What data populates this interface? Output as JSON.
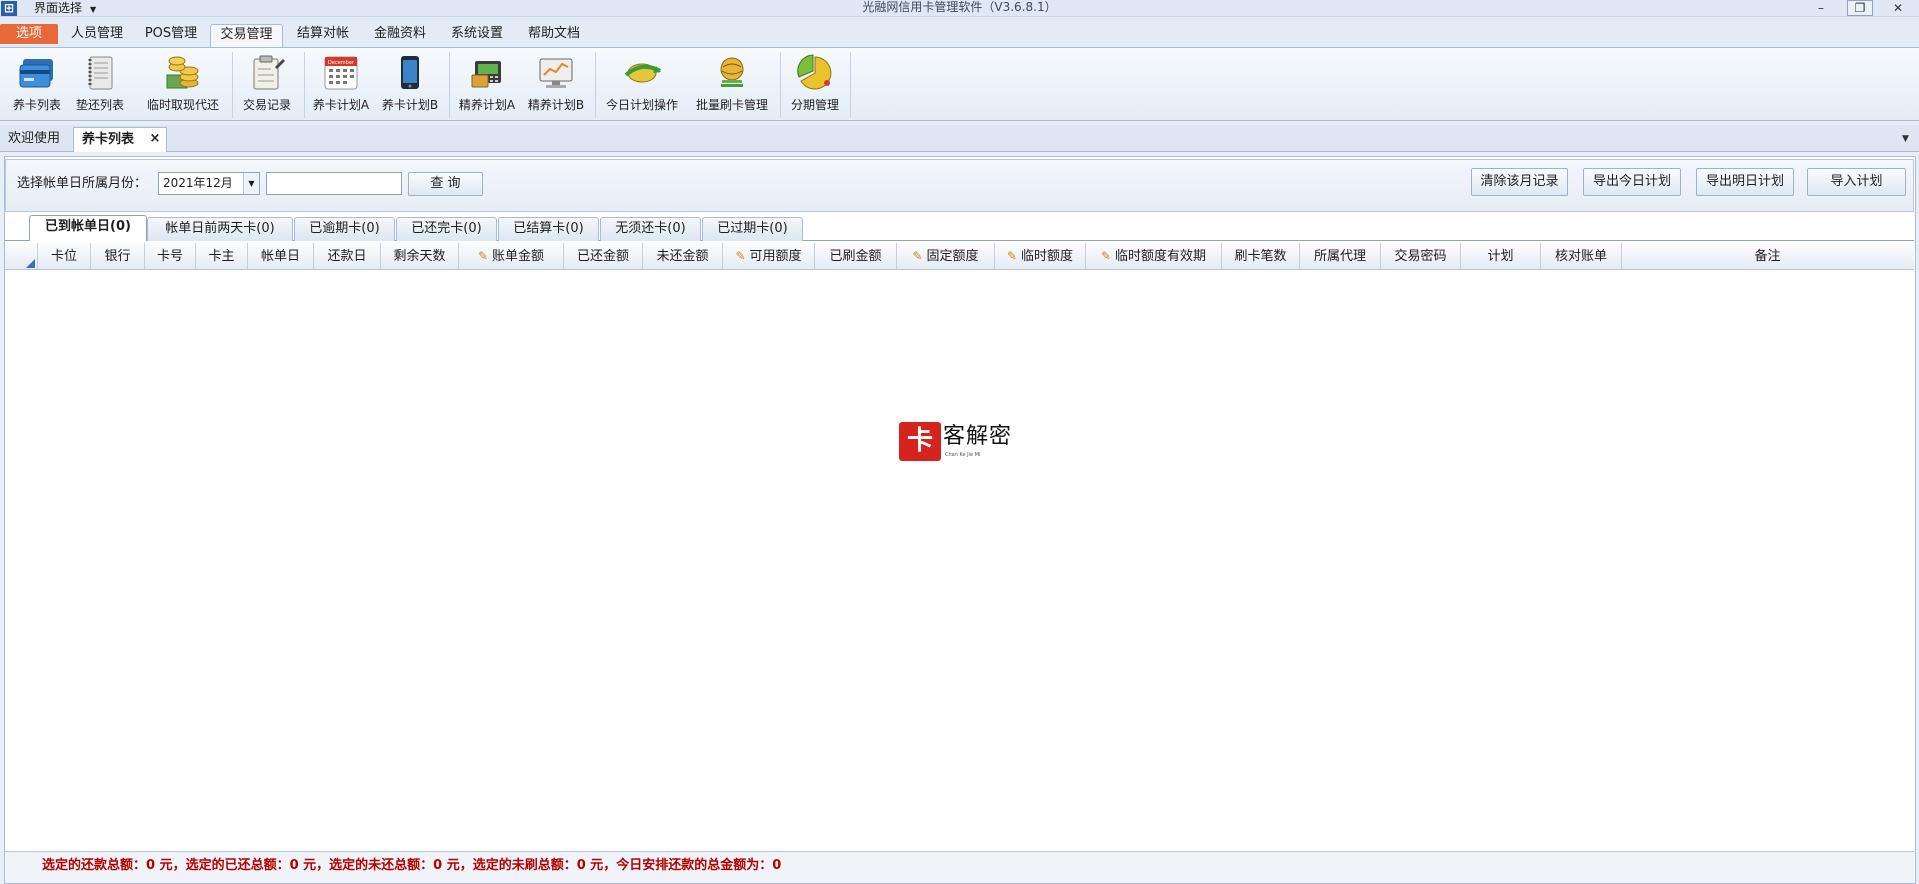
{
  "app": {
    "icon": "grid-app-icon",
    "view_select": "界面选择",
    "title": "光融网信用卡管理软件（V3.6.8.1）",
    "window_buttons": {
      "minimize": "–",
      "restore": "❐",
      "close": "✕"
    }
  },
  "menu_tabs": [
    "选项",
    "人员管理",
    "POS管理",
    "交易管理",
    "结算对帐",
    "金融资料",
    "系统设置",
    "帮助文档"
  ],
  "active_menu_tab": "交易管理",
  "ribbon": {
    "buttons": [
      {
        "label": "养卡列表",
        "icon": "card-list-icon"
      },
      {
        "label": "垫还列表",
        "icon": "notebook-icon"
      },
      {
        "label": "临时取现代还",
        "icon": "coins-icon"
      },
      {
        "label": "交易记录",
        "icon": "clipboard-icon"
      },
      {
        "label": "养卡计划A",
        "icon": "calendar-icon"
      },
      {
        "label": "养卡计划B",
        "icon": "phone-icon"
      },
      {
        "label": "精养计划A",
        "icon": "pos-terminal-icon"
      },
      {
        "label": "精养计划B",
        "icon": "monitor-chart-icon"
      },
      {
        "label": "今日计划操作",
        "icon": "globe-arrow-icon"
      },
      {
        "label": "批量刷卡管理",
        "icon": "globe-stack-icon"
      },
      {
        "label": "分期管理",
        "icon": "pie-chart-icon"
      }
    ],
    "calendar_icon_text": "December"
  },
  "doc_tabs": [
    "欢迎使用",
    "养卡列表"
  ],
  "doc_tab_close": "×",
  "filter": {
    "label": "选择帐单日所属月份：",
    "month": "2021年12月",
    "search_value": "",
    "query_button": "查 询",
    "buttons": [
      "清除该月记录",
      "导出今日计划",
      "导出明日计划",
      "导入计划"
    ]
  },
  "sub_tabs": [
    "已到帐单日(0)",
    "帐单日前两天卡(0)",
    "已逾期卡(0)",
    "已还完卡(0)",
    "已结算卡(0)",
    "无须还卡(0)",
    "已过期卡(0)"
  ],
  "columns": [
    {
      "label": "卡位",
      "editable": false
    },
    {
      "label": "银行",
      "editable": false
    },
    {
      "label": "卡号",
      "editable": false
    },
    {
      "label": "卡主",
      "editable": false
    },
    {
      "label": "帐单日",
      "editable": false
    },
    {
      "label": "还款日",
      "editable": false
    },
    {
      "label": "剩余天数",
      "editable": false
    },
    {
      "label": "账单金额",
      "editable": true
    },
    {
      "label": "已还金额",
      "editable": false
    },
    {
      "label": "未还金额",
      "editable": false
    },
    {
      "label": "可用额度",
      "editable": true
    },
    {
      "label": "已刷金额",
      "editable": false
    },
    {
      "label": "固定额度",
      "editable": true
    },
    {
      "label": "临时额度",
      "editable": true
    },
    {
      "label": "临时额度有效期",
      "editable": true
    },
    {
      "label": "刷卡笔数",
      "editable": false
    },
    {
      "label": "所属代理",
      "editable": false
    },
    {
      "label": "交易密码",
      "editable": false
    },
    {
      "label": "计划",
      "editable": false
    },
    {
      "label": "核对账单",
      "editable": false
    },
    {
      "label": "备注",
      "editable": false
    }
  ],
  "rows": [],
  "watermark": {
    "logo_char": "卡",
    "text": "客解密",
    "sub": "Chan Ke Jie Mi"
  },
  "footer": "选定的还款总额：0 元，选定的已还总额：0 元，选定的未还总额：0 元，选定的未刷总额：0 元，今日安排还款的总金额为：0",
  "colors": {
    "accent_tab": "#e8683a",
    "border": "#a9bcd6",
    "footer_text": "#b30000",
    "watermark_red": "#d5231e"
  }
}
